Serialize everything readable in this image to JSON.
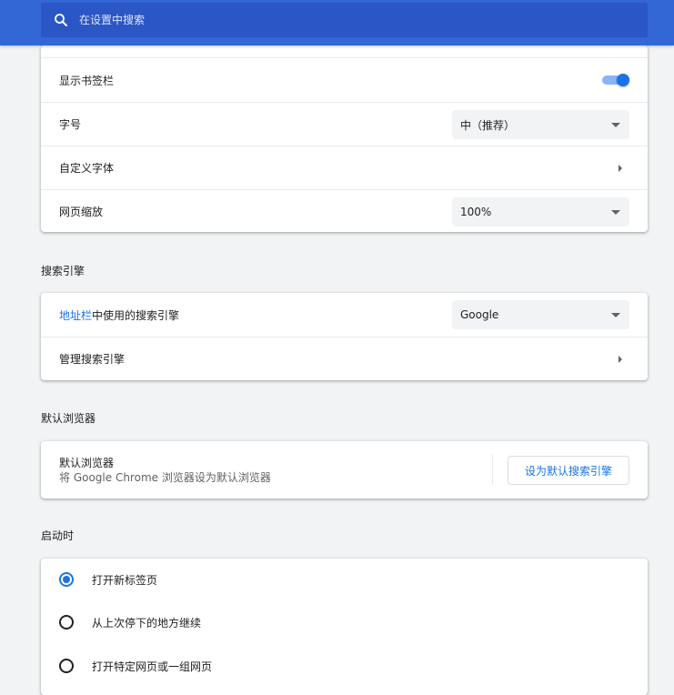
{
  "search": {
    "placeholder": "在设置中搜索"
  },
  "appearance": {
    "rows": [
      {
        "label": "显示书签栏",
        "control": "toggle",
        "on": true
      },
      {
        "label": "字号",
        "control": "select",
        "value": "中（推荐）"
      },
      {
        "label": "自定义字体",
        "control": "arrow"
      },
      {
        "label": "网页缩放",
        "control": "select",
        "value": "100%"
      }
    ]
  },
  "search_engine": {
    "title": "搜索引擎",
    "engine_row": {
      "label_link": "地址栏",
      "label_rest": "中使用的搜索引擎",
      "value": "Google"
    },
    "manage_label": "管理搜索引擎"
  },
  "default_browser": {
    "title": "默认浏览器",
    "row_title": "默认浏览器",
    "row_sub": "将 Google Chrome 浏览器设为默认浏览器",
    "button_label": "设为默认搜索引擎"
  },
  "startup": {
    "title": "启动时",
    "options": [
      {
        "label": "打开新标签页",
        "checked": true
      },
      {
        "label": "从上次停下的地方继续",
        "checked": false
      },
      {
        "label": "打开特定网页或一组网页",
        "checked": false
      }
    ]
  },
  "colors": {
    "header_bg": "#3367d6",
    "accent": "#1a73e8"
  }
}
